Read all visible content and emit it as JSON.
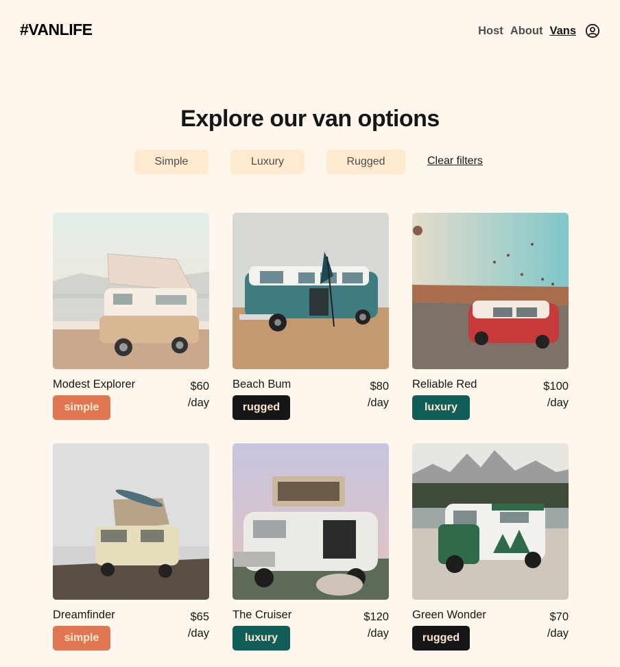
{
  "header": {
    "logo": "#VANLIFE",
    "nav": [
      {
        "label": "Host",
        "active": false
      },
      {
        "label": "About",
        "active": false
      },
      {
        "label": "Vans",
        "active": true
      }
    ],
    "user_icon": "user-circle-icon"
  },
  "main": {
    "title": "Explore our van options",
    "filters": [
      "Simple",
      "Luxury",
      "Rugged"
    ],
    "clear_filters": "Clear filters"
  },
  "vans": [
    {
      "name": "Modest Explorer",
      "price": "$60",
      "unit": "/day",
      "type": "simple"
    },
    {
      "name": "Beach Bum",
      "price": "$80",
      "unit": "/day",
      "type": "rugged"
    },
    {
      "name": "Reliable Red",
      "price": "$100",
      "unit": "/day",
      "type": "luxury"
    },
    {
      "name": "Dreamfinder",
      "price": "$65",
      "unit": "/day",
      "type": "simple"
    },
    {
      "name": "The Cruiser",
      "price": "$120",
      "unit": "/day",
      "type": "luxury"
    },
    {
      "name": "Green Wonder",
      "price": "$70",
      "unit": "/day",
      "type": "rugged"
    }
  ],
  "colors": {
    "background": "#FFF7ED",
    "filter_bg": "#FFEAD0",
    "simple": "#E17654",
    "rugged": "#161616",
    "luxury": "#115E59"
  }
}
